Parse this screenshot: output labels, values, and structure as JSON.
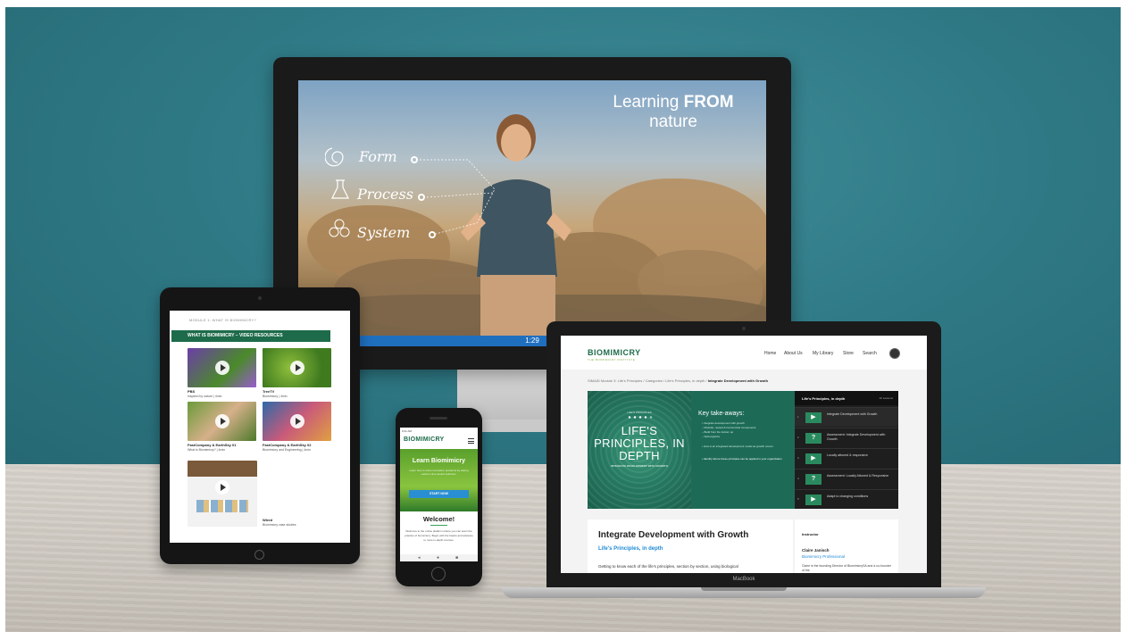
{
  "imac": {
    "headline_light": "Learning",
    "headline_bold": "FROM",
    "headline_line2": "nature",
    "items": [
      "Form",
      "Process",
      "System"
    ],
    "timestamp": "1:29"
  },
  "ipad": {
    "breadcrumb": "MODULE 1: WHAT IS BIOMIMICRY?",
    "header": "WHAT IS BIOMIMICRY – VIDEO RESOURCES",
    "videos": [
      {
        "title": "PBS",
        "subtitle": "Inspired by nature  |  4min"
      },
      {
        "title": "TreeTV",
        "subtitle": "Biomimicry  |  4min"
      },
      {
        "title": "FastCompany & EarthSky 01",
        "subtitle": "What is Biomimicry?  |  4min"
      },
      {
        "title": "FastCompany & EarthSky 02",
        "subtitle": "Biomimicry and Engineering  |  4min"
      },
      {
        "title": "Wired",
        "subtitle": "Biomimicry case studies"
      }
    ]
  },
  "iphone": {
    "status": "9:41 AM",
    "logo": "BIOMIMICRY",
    "hero_title": "Learn Biomimicry",
    "hero_text": "Learn how to solve innovation problems by asking nature's time-tested solutions.",
    "hero_button": "START NOW",
    "welcome": "Welcome!",
    "body": "Welcome to the online platform where you can learn the practice of biomimicry. Begin with the basics and advance to more in-depth courses."
  },
  "macbook": {
    "label": "MacBook",
    "logo": "BIOMIMICRY",
    "tagline": "THE BIOMIMICRY INSTITUTE",
    "nav": [
      "Home",
      "About Us",
      "My Library",
      "Store",
      "Search"
    ],
    "breadcrumb_prefix": "SIMAID Module 3: Life's Principles / Categories / Life's Principles, in depth / ",
    "breadcrumb_current": "Integrate Development with Growth",
    "hero_sup": "LIFE'S PRINCIPLES",
    "hero_title": "LIFE'S PRINCIPLES, IN DEPTH",
    "hero_sub": "INTEGRATE DEVELOPMENT WITH GROWTH",
    "key_title": "Key take-aways:",
    "key_items": [
      "• Integrate development with growth",
      "   – Modular, nested & harmonized components",
      "   – Build from the bottom up",
      "   – Self-organize",
      "• How is an integrated development model as growth occurs",
      "• Identify where these principles can be applied in your organization"
    ],
    "sidebar_title": "Life's Principles, in depth",
    "sidebar_count": "10 Lessons",
    "lessons": [
      {
        "num": "1",
        "icon": "▶",
        "label": "Integrate Development with Growth"
      },
      {
        "num": "2",
        "icon": "?",
        "label": "Assessment: Integrate Development with Growth"
      },
      {
        "num": "3",
        "icon": "▶",
        "label": "Locally attuned & responsive"
      },
      {
        "num": "4",
        "icon": "?",
        "label": "Assessment: Locally Attuned & Responsive"
      },
      {
        "num": "5",
        "icon": "▶",
        "label": "Adapt to changing conditions"
      }
    ],
    "content_title": "Integrate Development with Growth",
    "content_subtitle": "Life's Principles, in depth",
    "content_text": "Getting to know each of the life's principles, section by section, using biological",
    "instructor_label": "Instructor",
    "instructor_name": "Claire Janisch",
    "instructor_role": "Biomimicry Professional",
    "instructor_bio": "Claire is the founding Director of BiomimicrySA and a co-founder of the"
  },
  "colors": {
    "wall": "#2f7a86",
    "brand_green": "#1d6b4a",
    "accent_blue": "#1f8ad6"
  }
}
